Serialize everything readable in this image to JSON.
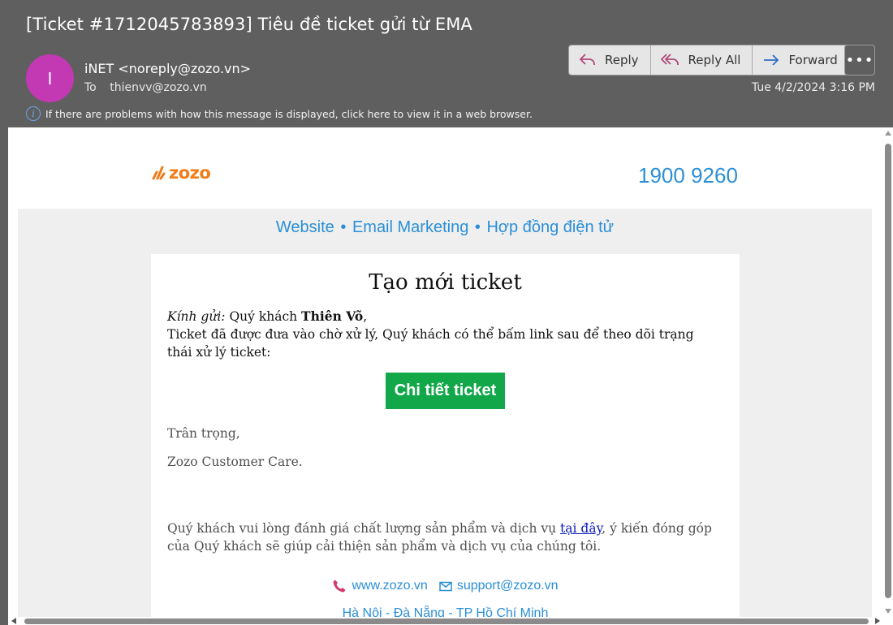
{
  "email": {
    "subject": "[Ticket #1712045783893] Tiêu đề ticket gửi từ EMA",
    "avatar_letter": "I",
    "avatar_color": "#c239b3",
    "from": "iNET <noreply@zozo.vn>",
    "to_label": "To",
    "to": "thienvv@zozo.vn",
    "date": "Tue 4/2/2024 3:16 PM",
    "info_text": "If there are problems with how this message is displayed, click here to view it in a web browser."
  },
  "actions": {
    "reply": "Reply",
    "reply_all": "Reply All",
    "forward": "Forward",
    "more": "•••"
  },
  "content": {
    "logo_text": "zozo",
    "phone": "1900 9260",
    "nav": [
      "Website",
      "Email Marketing",
      "Hợp đồng điện tử"
    ],
    "nav_sep": "•",
    "title": "Tạo mới ticket",
    "greeting_label": "Kính gửi:",
    "greeting_text": "Quý khách",
    "customer_name": "Thiên Võ",
    "greeting_end": ",",
    "body_text": "Ticket đã được đưa vào chờ xử lý, Quý khách có thể bấm link sau để theo dõi trạng thái xử lý ticket:",
    "button_label": "Chi tiết ticket",
    "regards": "Trân trọng,",
    "signature": "Zozo Customer Care.",
    "feedback_before": "Quý khách vui lòng đánh giá chất lượng sản phẩm và dịch vụ",
    "feedback_link": "tại đây",
    "feedback_after": ", ý kiến đóng góp của Quý khách sẽ giúp cải thiện sản phẩm và dịch vụ của chúng tôi.",
    "website": "www.zozo.vn",
    "support_email": "support@zozo.vn",
    "cities": "Hà Nội - Đà Nẵng - TP Hồ Chí Minh"
  },
  "colors": {
    "header_bg": "#5f5f5f",
    "link_blue": "#2a8fd6",
    "button_green": "#12a84a",
    "logo_orange": "#f07d1a"
  }
}
